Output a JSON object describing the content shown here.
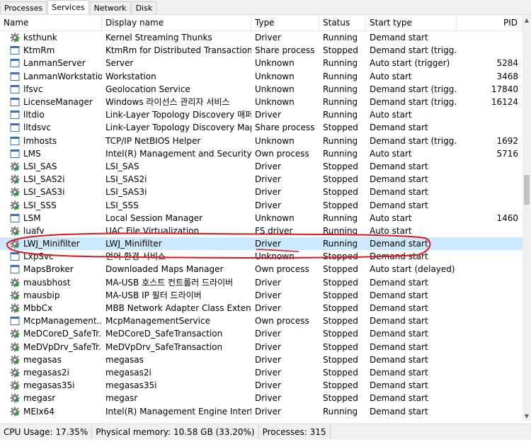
{
  "tabs": [
    "Processes",
    "Services",
    "Network",
    "Disk"
  ],
  "columns": [
    "Name",
    "Display name",
    "Type",
    "Status",
    "Start type",
    "PID"
  ],
  "rows": [
    {
      "name": "ksthunk",
      "display": "Kernel Streaming Thunks",
      "type": "Driver",
      "status": "Running",
      "start": "Demand start",
      "pid": "",
      "icon": "gear-icon"
    },
    {
      "name": "KtmRm",
      "display": "KtmRm for Distributed Transaction C...",
      "type": "Share process",
      "status": "Stopped",
      "start": "Demand start (trigg...",
      "pid": "",
      "icon": "window-icon"
    },
    {
      "name": "LanmanServer",
      "display": "Server",
      "type": "Unknown",
      "status": "Running",
      "start": "Auto start (trigger)",
      "pid": "5284",
      "icon": "window-icon"
    },
    {
      "name": "LanmanWorkstation",
      "display": "Workstation",
      "type": "Unknown",
      "status": "Running",
      "start": "Auto start",
      "pid": "3468",
      "icon": "window-icon"
    },
    {
      "name": "lfsvc",
      "display": "Geolocation Service",
      "type": "Unknown",
      "status": "Running",
      "start": "Demand start (trigg...",
      "pid": "17840",
      "icon": "window-icon"
    },
    {
      "name": "LicenseManager",
      "display": "Windows 라이선스 관리자 서비스",
      "type": "Unknown",
      "status": "Running",
      "start": "Demand start (trigg...",
      "pid": "16124",
      "icon": "window-icon"
    },
    {
      "name": "lltdio",
      "display": "Link-Layer Topology Discovery 매퍼 ...",
      "type": "Driver",
      "status": "Running",
      "start": "Auto start",
      "pid": "",
      "icon": "window-icon"
    },
    {
      "name": "lltdsvc",
      "display": "Link-Layer Topology Discovery Map...",
      "type": "Share process",
      "status": "Stopped",
      "start": "Demand start",
      "pid": "",
      "icon": "window-icon"
    },
    {
      "name": "lmhosts",
      "display": "TCP/IP NetBIOS Helper",
      "type": "Unknown",
      "status": "Running",
      "start": "Demand start (trigg...",
      "pid": "1692",
      "icon": "window-icon"
    },
    {
      "name": "LMS",
      "display": "Intel(R) Management and Security A...",
      "type": "Own process",
      "status": "Running",
      "start": "Auto start",
      "pid": "5716",
      "icon": "window-icon"
    },
    {
      "name": "LSI_SAS",
      "display": "LSI_SAS",
      "type": "Driver",
      "status": "Stopped",
      "start": "Demand start",
      "pid": "",
      "icon": "gear-icon"
    },
    {
      "name": "LSI_SAS2i",
      "display": "LSI_SAS2i",
      "type": "Driver",
      "status": "Stopped",
      "start": "Demand start",
      "pid": "",
      "icon": "gear-icon"
    },
    {
      "name": "LSI_SAS3i",
      "display": "LSI_SAS3i",
      "type": "Driver",
      "status": "Stopped",
      "start": "Demand start",
      "pid": "",
      "icon": "gear-icon"
    },
    {
      "name": "LSI_SSS",
      "display": "LSI_SSS",
      "type": "Driver",
      "status": "Stopped",
      "start": "Demand start",
      "pid": "",
      "icon": "gear-icon"
    },
    {
      "name": "LSM",
      "display": "Local Session Manager",
      "type": "Unknown",
      "status": "Running",
      "start": "Auto start",
      "pid": "1460",
      "icon": "window-icon"
    },
    {
      "name": "luafv",
      "display": "UAC File Virtualization",
      "type": "FS driver",
      "status": "Running",
      "start": "Auto start",
      "pid": "",
      "icon": "gear-icon"
    },
    {
      "name": "LWJ_Minifilter",
      "display": "LWJ_Minifilter",
      "type": "Driver",
      "status": "Running",
      "start": "Demand start",
      "pid": "",
      "icon": "gear-icon",
      "selected": true
    },
    {
      "name": "LxpSvc",
      "display": "언어 환경 서비스",
      "type": "Unknown",
      "status": "Stopped",
      "start": "Demand start",
      "pid": "",
      "icon": "window-icon"
    },
    {
      "name": "MapsBroker",
      "display": "Downloaded Maps Manager",
      "type": "Own process",
      "status": "Stopped",
      "start": "Auto start (delayed)",
      "pid": "",
      "icon": "window-icon"
    },
    {
      "name": "mausbhost",
      "display": "MA-USB 호스트 컨트롤러 드라이버",
      "type": "Driver",
      "status": "Stopped",
      "start": "Demand start",
      "pid": "",
      "icon": "gear-icon"
    },
    {
      "name": "mausbip",
      "display": "MA-USB IP 필터 드라이버",
      "type": "Driver",
      "status": "Stopped",
      "start": "Demand start",
      "pid": "",
      "icon": "gear-icon"
    },
    {
      "name": "MbbCx",
      "display": "MBB Network Adapter Class Extension",
      "type": "Driver",
      "status": "Stopped",
      "start": "Demand start",
      "pid": "",
      "icon": "gear-icon"
    },
    {
      "name": "McpManagement...",
      "display": "McpManagementService",
      "type": "Own process",
      "status": "Stopped",
      "start": "Demand start",
      "pid": "",
      "icon": "window-icon"
    },
    {
      "name": "MeDCoreD_SafeTr...",
      "display": "MeDCoreD_SafeTransaction",
      "type": "Driver",
      "status": "Stopped",
      "start": "Demand start",
      "pid": "",
      "icon": "gear-icon"
    },
    {
      "name": "MeDVpDrv_SafeTr...",
      "display": "MeDVpDrv_SafeTransaction",
      "type": "Driver",
      "status": "Stopped",
      "start": "Demand start",
      "pid": "",
      "icon": "gear-icon"
    },
    {
      "name": "megasas",
      "display": "megasas",
      "type": "Driver",
      "status": "Stopped",
      "start": "Demand start",
      "pid": "",
      "icon": "gear-icon"
    },
    {
      "name": "megasas2i",
      "display": "megasas2i",
      "type": "Driver",
      "status": "Stopped",
      "start": "Demand start",
      "pid": "",
      "icon": "gear-icon"
    },
    {
      "name": "megasas35i",
      "display": "megasas35i",
      "type": "Driver",
      "status": "Stopped",
      "start": "Demand start",
      "pid": "",
      "icon": "gear-icon"
    },
    {
      "name": "megasr",
      "display": "megasr",
      "type": "Driver",
      "status": "Stopped",
      "start": "Demand start",
      "pid": "",
      "icon": "gear-icon"
    },
    {
      "name": "MEIx64",
      "display": "Intel(R) Management Engine Interface",
      "type": "Driver",
      "status": "Running",
      "start": "Demand start",
      "pid": "",
      "icon": "gear-icon"
    }
  ],
  "status_bar": {
    "cpu": "CPU Usage: 17.35%",
    "memory": "Physical memory: 10.58 GB (33.20%)",
    "processes": "Processes: 315"
  },
  "colors": {
    "selection": "#cce8ff",
    "annotation": "#e0161b"
  }
}
